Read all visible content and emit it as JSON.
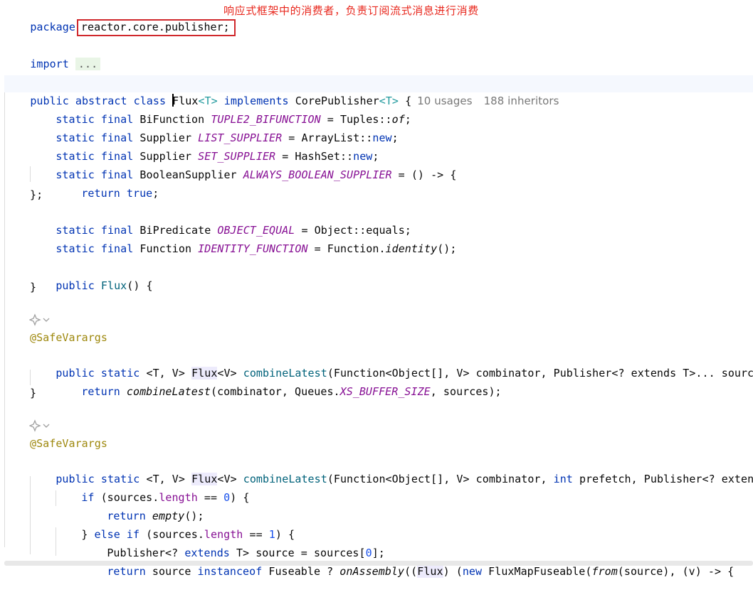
{
  "package": {
    "keyword": "package",
    "name": "reactor.core.publisher;"
  },
  "note": "响应式框架中的消费者，负责订阅流式消息进行消费",
  "import": {
    "keyword": "import",
    "folded": "..."
  },
  "class_decl": {
    "modifiers": "public abstract class",
    "name": "Flux",
    "type_param": "<T>",
    "implements_kw": "implements",
    "iface": "CorePublisher",
    "iface_param": "<T>",
    "brace": " {",
    "usages_hint": "10 usages",
    "inheritors_hint": "188 inheritors"
  },
  "fields": [
    {
      "mods": "static final",
      "type": "BiFunction",
      "name": "TUPLE2_BIFUNCTION",
      "eq": " = ",
      "owner": "Tuples",
      "sep": "::",
      "ref": "of",
      "tail": ";"
    },
    {
      "mods": "static final",
      "type": "Supplier",
      "name": "LIST_SUPPLIER",
      "eq": " = ",
      "owner": "ArrayList",
      "sep": "::",
      "ref": "new",
      "tail": ";"
    },
    {
      "mods": "static final",
      "type": "Supplier",
      "name": "SET_SUPPLIER",
      "eq": " = ",
      "owner": "HashSet",
      "sep": "::",
      "ref": "new",
      "tail": ";"
    },
    {
      "mods": "static final",
      "type": "BooleanSupplier",
      "name": "ALWAYS_BOOLEAN_SUPPLIER",
      "eq": " = ",
      "lambda": "() -> {"
    }
  ],
  "lambda_body": {
    "kw": "return",
    "val": "true",
    "tail": ";"
  },
  "lambda_close": "};",
  "fields2": [
    {
      "mods": "static final",
      "type": "BiPredicate",
      "name": "OBJECT_EQUAL",
      "eq": " = ",
      "owner": "Object",
      "sep": "::",
      "ref": "equals",
      "tail": ";"
    },
    {
      "mods": "static final",
      "type": "Function",
      "name": "IDENTITY_FUNCTION",
      "eq": " = ",
      "owner": "Function",
      "sep": ".",
      "ref": "identity",
      "tail": "();"
    }
  ],
  "ctor": {
    "kw": "public",
    "name": "Flux",
    "sig": "() {",
    "close": "}"
  },
  "annotation": "@SafeVarargs",
  "method1": {
    "kw": "public static",
    "generic": "<T, V>",
    "ret": "Flux",
    "ret_param": "<V>",
    "name": "combineLatest",
    "params": "(Function<Object[], V> combinator, Publisher<? extends T>... sources) {",
    "body_kw": "return",
    "body_call": "combineLatest",
    "body_args_a": "(combinator, Queues.",
    "body_const": "XS_BUFFER_SIZE",
    "body_args_b": ", sources);",
    "close": "}"
  },
  "method2": {
    "kw": "public static",
    "generic": "<T, V>",
    "ret": "Flux",
    "ret_param": "<V>",
    "name": "combineLatest",
    "params_a": "(Function<Object[], V> combinator, ",
    "int_kw": "int",
    "params_b": " prefetch, Publisher<? extends T>",
    "if1": {
      "kw": "if",
      "a": " (sources.",
      "f": "length",
      "b": " == ",
      "n": "0",
      "c": ") {"
    },
    "ret_empty": {
      "kw": "return",
      "call": "empty",
      "tail": "();"
    },
    "elseif": {
      "a": "} ",
      "kw1": "else",
      "kw2": "if",
      "b": " (sources.",
      "f": "length",
      "c": " == ",
      "n": "1",
      "d": ") {"
    },
    "pub_line": {
      "a": "Publisher<? ",
      "kw": "extends",
      "b": " T> source = sources[",
      "n": "0",
      "c": "];"
    },
    "last_line": {
      "kw": "return",
      "a": " source ",
      "kw2": "instanceof",
      "b": " Fuseable ? ",
      "call": "onAssembly",
      "c": "((",
      "cast": "Flux",
      "d": ") (",
      "kw3": "new",
      "e": " FluxMapFuseable(",
      "from": "from",
      "f": "(source), (v) -> {"
    }
  },
  "gutter_icon": "inlay-hints-icon"
}
